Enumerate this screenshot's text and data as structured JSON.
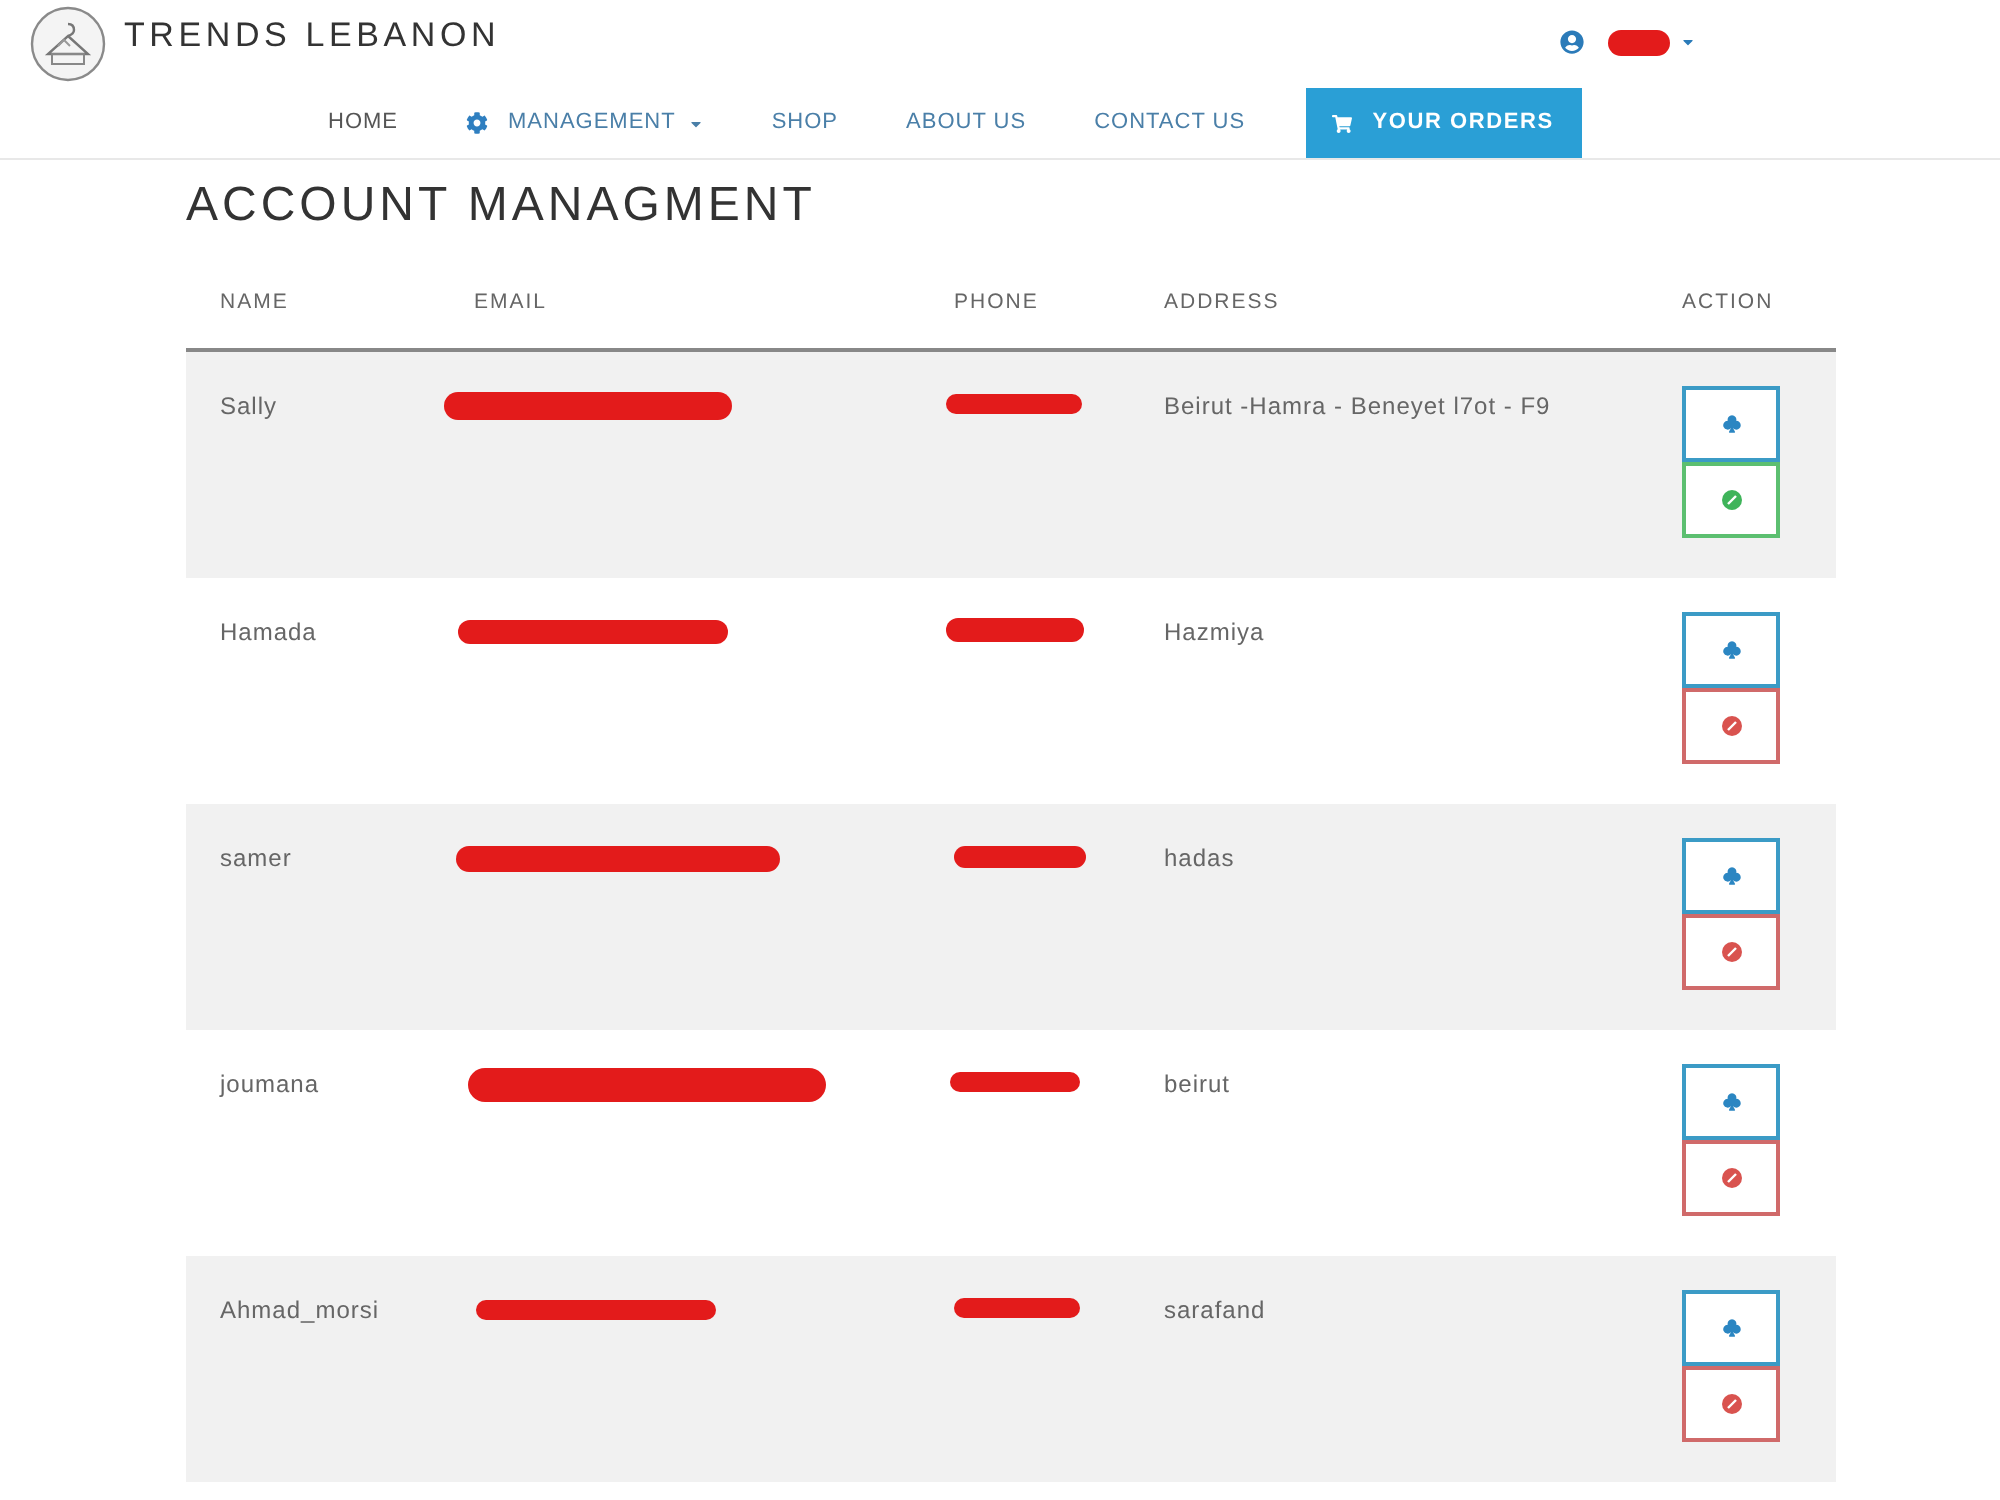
{
  "header": {
    "brand": "TRENDS LEBANON"
  },
  "nav": [
    {
      "label": "HOME",
      "kind": "link",
      "selected": true
    },
    {
      "label": "MANAGEMENT",
      "kind": "dropdown",
      "selected": false
    },
    {
      "label": "SHOP",
      "kind": "link",
      "selected": false
    },
    {
      "label": "ABOUT US",
      "kind": "link",
      "selected": false
    },
    {
      "label": "CONTACT US",
      "kind": "link",
      "selected": false
    },
    {
      "label": "YOUR ORDERS",
      "kind": "button",
      "selected": false
    }
  ],
  "page_title": "ACCOUNT MANAGMENT",
  "table": {
    "columns": [
      "NAME",
      "EMAIL",
      "PHONE",
      "ADDRESS",
      "ACTION"
    ],
    "rows": [
      {
        "name": "Sally",
        "address": "Beirut -Hamra - Beneyet l7ot - F9",
        "active": false
      },
      {
        "name": "Hamada",
        "address": "Hazmiya",
        "active": true
      },
      {
        "name": "samer",
        "address": "hadas",
        "active": true
      },
      {
        "name": "joumana",
        "address": "beirut",
        "active": true
      },
      {
        "name": "Ahmad_morsi",
        "address": "sarafand",
        "active": true
      }
    ]
  }
}
